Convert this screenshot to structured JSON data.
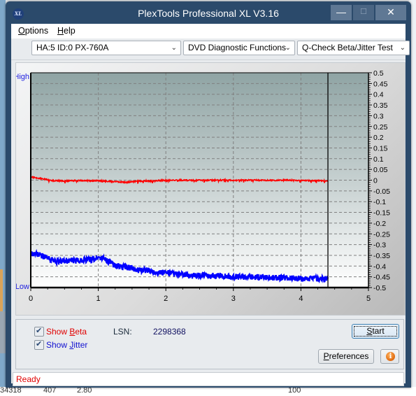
{
  "window": {
    "title": "PlexTools Professional XL V3.16",
    "icon_label": "XL",
    "controls": {
      "minimize": "—",
      "maximize": "☐",
      "close": "✕"
    }
  },
  "menu": {
    "items": [
      {
        "label": "Options",
        "accel": "O",
        "rest": "ptions"
      },
      {
        "label": "Help",
        "accel": "H",
        "rest": "elp"
      }
    ]
  },
  "toolbar": {
    "drive_select": "HA:5 ID:0  PX-760A",
    "function_select": "DVD Diagnostic Functions",
    "test_select": "Q-Check Beta/Jitter Test",
    "dropdown_arrow": "⌄"
  },
  "chart_data": {
    "type": "line",
    "title": "",
    "xlabel": "",
    "ylabel": "",
    "left_axis_labels": {
      "top": "High",
      "bottom": "Low"
    },
    "xlim": [
      0,
      5
    ],
    "ylim": [
      -0.5,
      0.5
    ],
    "x_ticks": [
      "0",
      "1",
      "2",
      "3",
      "4",
      "5"
    ],
    "y_ticks": [
      "0.5",
      "0.45",
      "0.4",
      "0.35",
      "0.3",
      "0.25",
      "0.2",
      "0.15",
      "0.1",
      "0.05",
      "0",
      "-0.05",
      "-0.1",
      "-0.15",
      "-0.2",
      "-0.25",
      "-0.3",
      "-0.35",
      "-0.4",
      "-0.45",
      "-0.5"
    ],
    "grid": true,
    "end_marker_x": 4.4,
    "colors": {
      "beta": "#ff0000",
      "jitter": "#0000ff",
      "grid": "#808080"
    },
    "series": [
      {
        "name": "Beta",
        "x": [
          0,
          0.1,
          0.2,
          0.3,
          0.4,
          0.5,
          0.6,
          0.7,
          0.8,
          0.9,
          1.0,
          1.1,
          1.2,
          1.3,
          1.4,
          1.5,
          1.6,
          1.7,
          1.8,
          1.9,
          2.0,
          2.2,
          2.4,
          2.6,
          2.8,
          3.0,
          3.2,
          3.4,
          3.6,
          3.8,
          4.0,
          4.2,
          4.4
        ],
        "values": [
          0.015,
          0.01,
          0.005,
          -0.002,
          -0.003,
          -0.004,
          -0.003,
          -0.002,
          -0.002,
          -0.003,
          -0.002,
          -0.004,
          -0.006,
          -0.008,
          -0.01,
          -0.008,
          -0.004,
          -0.003,
          -0.005,
          -0.002,
          -0.001,
          0.0,
          -0.001,
          0.0,
          0.0,
          -0.001,
          0.0,
          0.0,
          -0.001,
          0.0,
          -0.002,
          -0.002,
          -0.004
        ]
      },
      {
        "name": "Jitter",
        "x": [
          0,
          0.1,
          0.2,
          0.3,
          0.4,
          0.5,
          0.6,
          0.7,
          0.8,
          0.9,
          1.0,
          1.1,
          1.2,
          1.3,
          1.4,
          1.5,
          1.6,
          1.7,
          1.8,
          1.9,
          2.0,
          2.2,
          2.4,
          2.6,
          2.8,
          3.0,
          3.2,
          3.4,
          3.6,
          3.8,
          4.0,
          4.2,
          4.4
        ],
        "values": [
          -0.34,
          -0.345,
          -0.355,
          -0.37,
          -0.38,
          -0.375,
          -0.375,
          -0.375,
          -0.37,
          -0.37,
          -0.36,
          -0.365,
          -0.39,
          -0.4,
          -0.405,
          -0.41,
          -0.42,
          -0.42,
          -0.425,
          -0.43,
          -0.43,
          -0.44,
          -0.445,
          -0.445,
          -0.445,
          -0.45,
          -0.45,
          -0.452,
          -0.455,
          -0.455,
          -0.458,
          -0.458,
          -0.46
        ]
      }
    ]
  },
  "controls": {
    "show_beta": {
      "label_pre": "Show ",
      "accel": "B",
      "label_post": "eta",
      "checked": true
    },
    "show_jitter": {
      "label_pre": "Show ",
      "accel": "J",
      "label_post": "itter",
      "checked": true
    },
    "lsn_label": "LSN:",
    "lsn_value": "2298368",
    "start_button": {
      "accel": "S",
      "rest": "tart"
    },
    "preferences_button": {
      "accel": "P",
      "rest": "references"
    },
    "info_button": "i"
  },
  "status": {
    "text": "Ready"
  },
  "background_app": {
    "cells": [
      "34318",
      "407",
      "2.80",
      "100"
    ]
  }
}
